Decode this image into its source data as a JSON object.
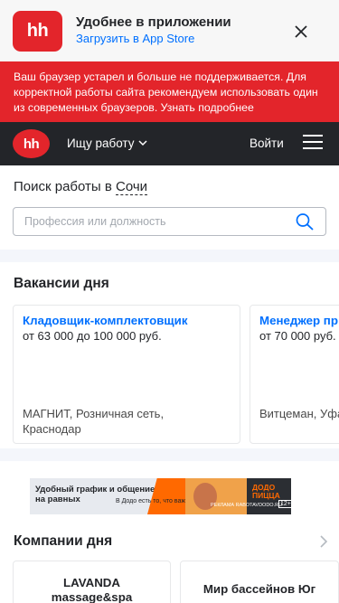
{
  "app_banner": {
    "logo_text": "hh",
    "title": "Удобнее в приложении",
    "link": "Загрузить в App Store"
  },
  "warning": {
    "text": "Ваш браузер устарел и больше не поддерживается. Для корректной работы сайта рекомендуем использовать один из современных браузеров. Узнать подробнее"
  },
  "header": {
    "logo_text": "hh",
    "job_menu": "Ищу работу",
    "login": "Войти"
  },
  "search": {
    "title_prefix": "Поиск работы в",
    "city": "Сочи",
    "placeholder": "Профессия или должность"
  },
  "vacancies": {
    "title": "Вакансии дня",
    "items": [
      {
        "title": "Кладовщик-комплектовщик",
        "salary": "от 63 000 до 100 000 руб.",
        "company": "МАГНИТ, Розничная сеть,",
        "city": "Краснодар"
      },
      {
        "title": "Менеджер пр",
        "salary": "от 70 000 руб.",
        "company": "",
        "city": "Витцеман, Уфа"
      }
    ]
  },
  "ad": {
    "text_line1": "Удобный график и общение",
    "text_line2": "на равных",
    "small": "В Додо есть то, что важно",
    "brand_line1": "ДОДО",
    "brand_line2": "ПИЦЦА",
    "note": "РЕКЛАМА RABOTAVDODO.RU",
    "age": "12+"
  },
  "companies": {
    "title": "Компании дня",
    "items": [
      {
        "name_line1": "LAVANDA",
        "name_line2": "massage&spa"
      },
      {
        "name_line1": "Мир бассейнов Юг",
        "name_line2": ""
      }
    ]
  },
  "colors": {
    "brand_red": "#e3252b",
    "link_blue": "#0070ff",
    "header_dark": "#232529"
  },
  "icons": [
    "close-icon",
    "chevron-down-icon",
    "menu-icon",
    "search-icon",
    "chevron-right-icon"
  ]
}
